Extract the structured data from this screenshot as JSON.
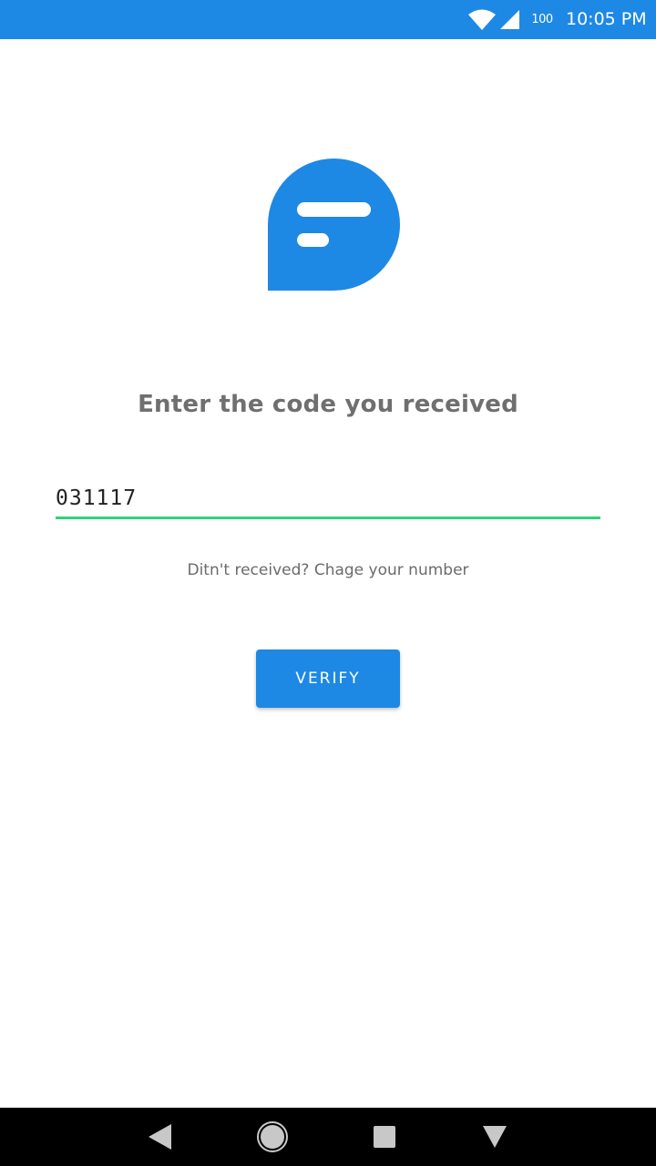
{
  "status_bar": {
    "battery_level": "100",
    "time": "10:05 PM",
    "icons": [
      "wifi-icon",
      "signal-icon",
      "battery-icon"
    ]
  },
  "logo": {
    "icon": "chat-bubble-logo",
    "color": "#1e88e5"
  },
  "verification": {
    "heading": "Enter the code you received",
    "code_value": "031117",
    "helper_text": "Ditn't received? Chage your number",
    "verify_label": "VERIFY"
  },
  "nav_bar": {
    "icons": [
      "back-icon",
      "home-icon",
      "recents-icon",
      "hide-keyboard-icon"
    ]
  },
  "colors": {
    "primary": "#1e88e5",
    "input_underline": "#2ed47a",
    "heading_text": "#6f6f6f"
  }
}
